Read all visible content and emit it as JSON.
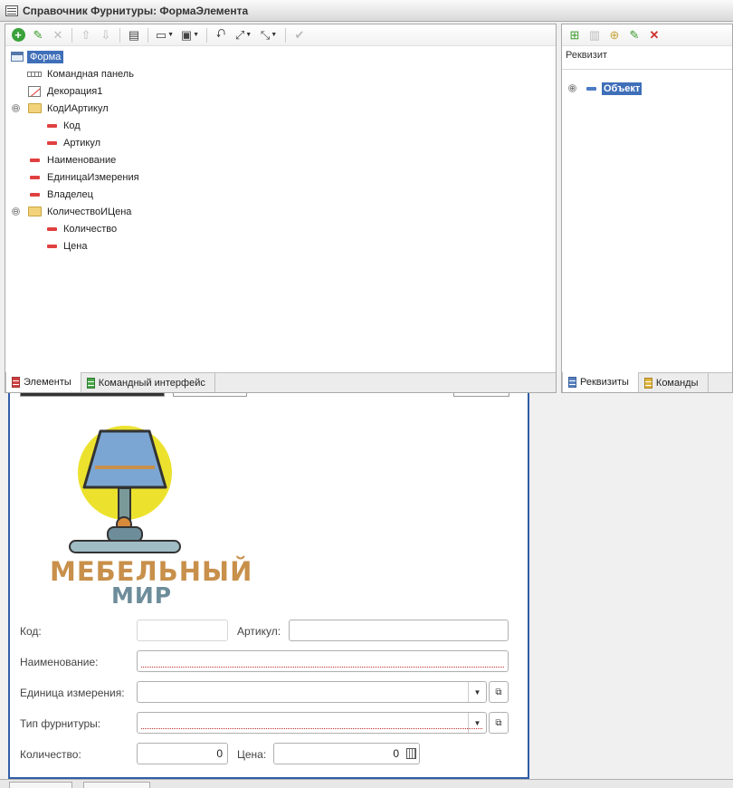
{
  "window": {
    "title": "Справочник Фурнитуры: ФормаЭлемента"
  },
  "tree": [
    {
      "label": "Форма",
      "selected": true,
      "icon": "form-icon"
    },
    {
      "label": "Командная панель",
      "icon": "command-panel-icon"
    },
    {
      "label": "Декорация1",
      "icon": "decoration-icon"
    },
    {
      "label": "КодИАртикул",
      "icon": "folder-icon",
      "expand": "⊖"
    },
    {
      "label": "Код",
      "icon": "field-icon"
    },
    {
      "label": "Артикул",
      "icon": "field-icon"
    },
    {
      "label": "Наименование",
      "icon": "field-icon"
    },
    {
      "label": "ЕдиницаИзмерения",
      "icon": "field-icon"
    },
    {
      "label": "Владелец",
      "icon": "field-icon"
    },
    {
      "label": "КоличествоИЦена",
      "icon": "folder-icon",
      "expand": "⊖"
    },
    {
      "label": "Количество",
      "icon": "field-icon"
    },
    {
      "label": "Цена",
      "icon": "field-icon"
    }
  ],
  "left_tabs": {
    "elements": "Элементы",
    "command_interface": "Командный интерфейс"
  },
  "right_panel": {
    "column_header": "Реквизит",
    "object_label": "Объект",
    "expand": "⊕",
    "tabs": {
      "attributes": "Реквизиты",
      "commands": "Команды"
    }
  },
  "logo": {
    "line1": "МЕБЕЛЬНЫЙ",
    "line2": "МИР"
  },
  "form": {
    "code_label": "Код:",
    "code_value": "",
    "article_label": "Артикул:",
    "article_value": "",
    "name_label": "Наименование:",
    "name_value": "",
    "unit_label": "Единица измерения:",
    "unit_value": "",
    "type_label": "Тип фурнитуры:",
    "type_value": "",
    "qty_label": "Количество:",
    "qty_value": "0",
    "price_label": "Цена:",
    "price_value": "0"
  },
  "colors": {
    "selection": "#3f6fb8",
    "logo_orange": "#c8904a",
    "logo_blue": "#6e8d9a",
    "logo_yellow": "#ece22e"
  }
}
